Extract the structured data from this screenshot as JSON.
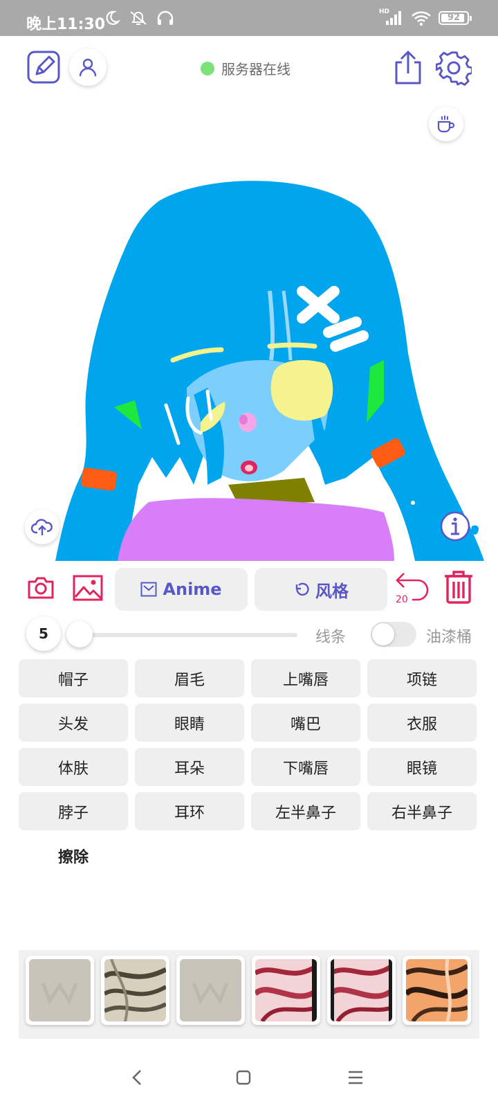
{
  "status_bar": {
    "time": "晚上11:30",
    "network_badge": "HD",
    "battery_level": "92",
    "battery_fraction": 0.92,
    "icons": [
      "moon-icon",
      "alarm-off-icon",
      "headphones-icon",
      "signal-icon",
      "wifi-icon",
      "battery-icon"
    ]
  },
  "header": {
    "server_status": "服务器在线",
    "server_status_color": "#7ee27a",
    "accent": "#5957c5",
    "icons": [
      "edit-note-icon",
      "user-icon",
      "share-icon",
      "settings-icon",
      "coffee-icon"
    ]
  },
  "canvas": {
    "icons": [
      "cloud-upload-icon",
      "info-icon"
    ]
  },
  "tools": {
    "anime_label": "Anime",
    "style_label": "风格",
    "undo_count": "20",
    "danger_color": "#e0245e",
    "icons": [
      "camera-icon",
      "image-icon",
      "mail-icon",
      "refresh-icon",
      "undo-icon",
      "trash-icon"
    ]
  },
  "brush": {
    "size": "5",
    "line_label": "线条",
    "bucket_label": "油漆桶",
    "bucket_enabled": false
  },
  "labels": [
    "帽子",
    "眉毛",
    "上嘴唇",
    "项链",
    "头发",
    "眼睛",
    "嘴巴",
    "衣服",
    "体肤",
    "耳朵",
    "下嘴唇",
    "眼镜",
    "脖子",
    "耳环",
    "左半鼻子",
    "右半鼻子",
    "擦除"
  ],
  "thumbnails": [
    "placeholder",
    "silver-marble",
    "placeholder",
    "red-swirl",
    "red-swirl",
    "orange-swirl"
  ],
  "navbar": {
    "icons": [
      "back-icon",
      "home-icon",
      "menu-icon"
    ]
  }
}
